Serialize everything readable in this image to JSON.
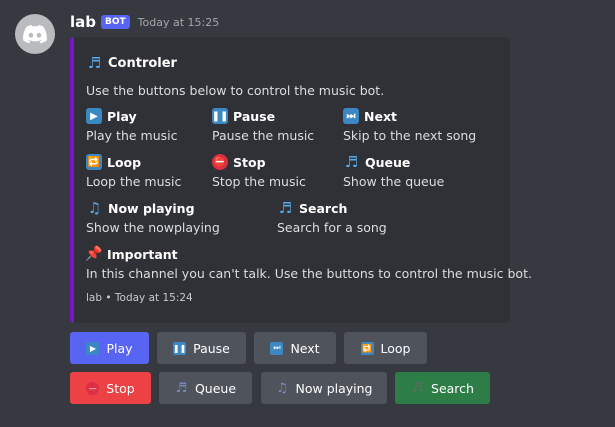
{
  "message": {
    "username": "lab",
    "bot_tag": "BOT",
    "timestamp": "Today at 15:25"
  },
  "embed": {
    "accent_color": "#7b14c9",
    "title": "Controler",
    "description": "Use the buttons below to control the music bot.",
    "fields": [
      {
        "icon": "play-icon",
        "name": "Play",
        "value": "Play the music"
      },
      {
        "icon": "pause-icon",
        "name": "Pause",
        "value": "Pause the music"
      },
      {
        "icon": "next-track-icon",
        "name": "Next",
        "value": "Skip to the next song"
      },
      {
        "icon": "loop-icon",
        "name": "Loop",
        "value": "Loop the music"
      },
      {
        "icon": "stop-icon",
        "name": "Stop",
        "value": "Stop the music"
      },
      {
        "icon": "music-notes-icon",
        "name": "Queue",
        "value": "Show the queue"
      },
      {
        "icon": "music-note-icon",
        "name": "Now playing",
        "value": "Show the nowplaying"
      },
      {
        "icon": "music-notes-icon",
        "name": "Search",
        "value": "Search for a song"
      }
    ],
    "important": {
      "icon": "pushpin-icon",
      "name": "Important",
      "value": "In this channel you can't talk. Use the buttons to control the music bot."
    },
    "footer": "lab • Today at 15:24"
  },
  "buttons": {
    "play": "Play",
    "pause": "Pause",
    "next": "Next",
    "loop": "Loop",
    "stop": "Stop",
    "queue": "Queue",
    "now_playing": "Now playing",
    "search": "Search"
  },
  "colors": {
    "background": "#36393f",
    "embed_bg": "#2f3136",
    "primary": "#5865f2",
    "secondary": "#4f545c",
    "danger": "#ed4245",
    "success": "#2d7d46"
  }
}
